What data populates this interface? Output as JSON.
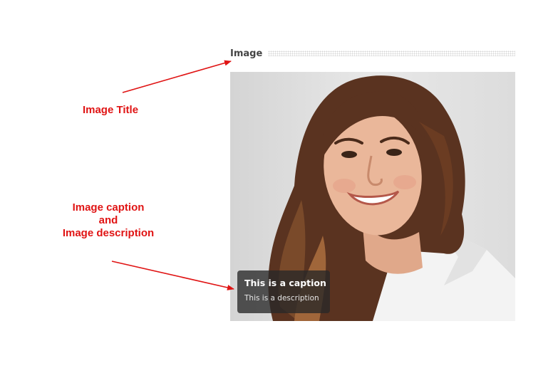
{
  "annotations": {
    "title_label": "Image Title",
    "caption_label_line1": "Image caption",
    "caption_label_line2": "and",
    "caption_label_line3": "Image description",
    "color": "#e01414"
  },
  "widget": {
    "title": "Image",
    "photo_icon": "portrait-photo",
    "caption": "This is a caption",
    "description": "This is a description"
  }
}
